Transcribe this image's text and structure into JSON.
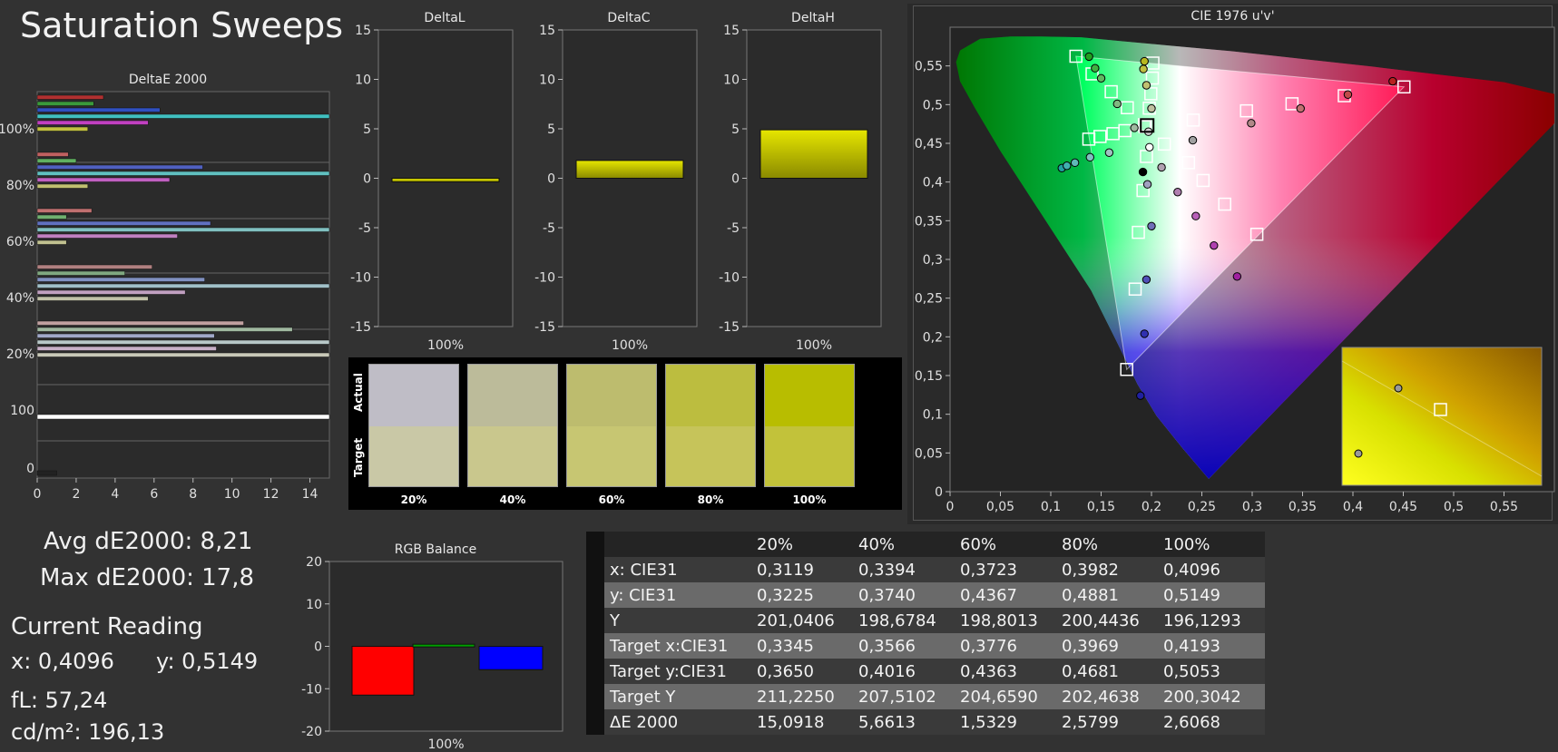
{
  "page_title": "Saturation Sweeps",
  "stats": {
    "avg": "Avg dE2000: 8,21",
    "max": "Max dE2000: 17,8",
    "current_heading": "Current Reading",
    "x": "x: 0,4096",
    "y": "y: 0,5149",
    "fl": "fL: 57,24",
    "cdm2": "cd/m²: 196,13"
  },
  "table": {
    "headers": [
      "20%",
      "40%",
      "60%",
      "80%",
      "100%"
    ],
    "rows": [
      {
        "label": "x: CIE31",
        "values": [
          "0,3119",
          "0,3394",
          "0,3723",
          "0,3982",
          "0,4096"
        ]
      },
      {
        "label": "y: CIE31",
        "values": [
          "0,3225",
          "0,3740",
          "0,4367",
          "0,4881",
          "0,5149"
        ]
      },
      {
        "label": "Y",
        "values": [
          "201,0406",
          "198,6784",
          "198,8013",
          "200,4436",
          "196,1293"
        ]
      },
      {
        "label": "Target x:CIE31",
        "values": [
          "0,3345",
          "0,3566",
          "0,3776",
          "0,3969",
          "0,4193"
        ]
      },
      {
        "label": "Target y:CIE31",
        "values": [
          "0,3650",
          "0,4016",
          "0,4363",
          "0,4681",
          "0,5053"
        ]
      },
      {
        "label": "Target Y",
        "values": [
          "211,2250",
          "207,5102",
          "204,6590",
          "202,4638",
          "200,3042"
        ]
      },
      {
        "label": "ΔE 2000",
        "values": [
          "15,0918",
          "5,6613",
          "1,5329",
          "2,5799",
          "2,6068"
        ]
      }
    ]
  },
  "swatches": {
    "actual_label": "Actual",
    "target_label": "Target",
    "items": [
      {
        "label": "20%",
        "actual": "#bfbdc6",
        "target": "#c9c8a6"
      },
      {
        "label": "40%",
        "actual": "#bcbb9a",
        "target": "#c9c78d"
      },
      {
        "label": "60%",
        "actual": "#bdbc6e",
        "target": "#c7c672"
      },
      {
        "label": "80%",
        "actual": "#bcbd3f",
        "target": "#c6c45a"
      },
      {
        "label": "100%",
        "actual": "#b8bd00",
        "target": "#c2c23a"
      }
    ]
  },
  "chart_data": [
    {
      "type": "bar",
      "orientation": "horizontal",
      "title": "DeltaE 2000",
      "x_ticks": [
        "0",
        "2",
        "4",
        "6",
        "8",
        "10",
        "12",
        "14"
      ],
      "xlim": [
        0,
        15
      ],
      "y_ticks": [
        "100%",
        "80%",
        "60%",
        "40%",
        "20%",
        "100",
        "0"
      ],
      "groups": [
        {
          "label": "100%",
          "bars": [
            {
              "value": 3.4,
              "color": "#b03030"
            },
            {
              "value": 2.9,
              "color": "#3a9a3a"
            },
            {
              "value": 6.3,
              "color": "#3050c0"
            },
            {
              "value": 17.8,
              "color": "#40c0c0"
            },
            {
              "value": 5.7,
              "color": "#c040c0"
            },
            {
              "value": 2.6,
              "color": "#c0c040"
            }
          ]
        },
        {
          "label": "80%",
          "bars": [
            {
              "value": 1.6,
              "color": "#c06060"
            },
            {
              "value": 2.0,
              "color": "#60b060"
            },
            {
              "value": 8.5,
              "color": "#5060c0"
            },
            {
              "value": 16.5,
              "color": "#60c0c0"
            },
            {
              "value": 6.8,
              "color": "#c060c0"
            },
            {
              "value": 2.6,
              "color": "#c0c070"
            }
          ]
        },
        {
          "label": "60%",
          "bars": [
            {
              "value": 2.8,
              "color": "#c07070"
            },
            {
              "value": 1.5,
              "color": "#70b070"
            },
            {
              "value": 8.9,
              "color": "#6070c0"
            },
            {
              "value": 16.0,
              "color": "#80c0c0"
            },
            {
              "value": 7.2,
              "color": "#c080c0"
            },
            {
              "value": 1.5,
              "color": "#c0c090"
            }
          ]
        },
        {
          "label": "40%",
          "bars": [
            {
              "value": 5.9,
              "color": "#b08080"
            },
            {
              "value": 4.5,
              "color": "#80a880"
            },
            {
              "value": 8.6,
              "color": "#8090c0"
            },
            {
              "value": 15.0,
              "color": "#a0c0c8"
            },
            {
              "value": 7.6,
              "color": "#c0a0c0"
            },
            {
              "value": 5.7,
              "color": "#c0c0a8"
            }
          ]
        },
        {
          "label": "20%",
          "bars": [
            {
              "value": 10.6,
              "color": "#c0a0a0"
            },
            {
              "value": 13.1,
              "color": "#a0b8a0"
            },
            {
              "value": 9.1,
              "color": "#a0a8c8"
            },
            {
              "value": 15.1,
              "color": "#b8c8c8"
            },
            {
              "value": 9.2,
              "color": "#c8b0c8"
            },
            {
              "value": 15.1,
              "color": "#c8c8b8"
            }
          ]
        },
        {
          "label": "100",
          "bars": [
            {
              "value": 15.0,
              "color": "#ffffff"
            }
          ]
        },
        {
          "label": "0",
          "bars": [
            {
              "value": 1.0,
              "color": "#222222"
            }
          ]
        }
      ]
    },
    {
      "type": "bar",
      "title": "DeltaL",
      "categories": [
        "100%"
      ],
      "values": [
        -0.3
      ],
      "ylim": [
        -15,
        15
      ],
      "y_ticks": [
        "15",
        "10",
        "5",
        "0",
        "-5",
        "-10",
        "-15"
      ],
      "color": "#c8c800"
    },
    {
      "type": "bar",
      "title": "DeltaC",
      "categories": [
        "100%"
      ],
      "values": [
        1.8
      ],
      "ylim": [
        -15,
        15
      ],
      "y_ticks": [
        "15",
        "10",
        "5",
        "0",
        "-5",
        "-10",
        "-15"
      ],
      "color": "#c8c800"
    },
    {
      "type": "bar",
      "title": "DeltaH",
      "categories": [
        "100%"
      ],
      "values": [
        4.9
      ],
      "ylim": [
        -15,
        15
      ],
      "y_ticks": [
        "15",
        "10",
        "5",
        "0",
        "-5",
        "-10",
        "-15"
      ],
      "color": "#c8c800"
    },
    {
      "type": "bar",
      "title": "RGB Balance",
      "categories": [
        "100%"
      ],
      "series": [
        {
          "values": [
            -11.5
          ],
          "color": "#ff0000"
        },
        {
          "values": [
            0.5
          ],
          "color": "#00a000"
        },
        {
          "values": [
            -5.5
          ],
          "color": "#0000ff"
        }
      ],
      "ylim": [
        -20,
        20
      ],
      "y_ticks": [
        "20",
        "10",
        "0",
        "-10",
        "-20"
      ]
    },
    {
      "type": "scatter",
      "title": "CIE 1976 u'v'",
      "xlim": [
        0,
        0.6
      ],
      "ylim": [
        0,
        0.6
      ],
      "x_ticks": [
        "0",
        "0,05",
        "0,1",
        "0,15",
        "0,2",
        "0,25",
        "0,3",
        "0,35",
        "0,4",
        "0,45",
        "0,5",
        "0,55"
      ],
      "y_ticks": [
        "0",
        "0,05",
        "0,1",
        "0,15",
        "0,2",
        "0,25",
        "0,3",
        "0,35",
        "0,4",
        "0,45",
        "0,5",
        "0,55"
      ],
      "gamut": {
        "red": [
          0.4507,
          0.5229
        ],
        "green": [
          0.125,
          0.5625
        ],
        "blue": [
          0.1754,
          0.1579
        ]
      },
      "targets": [
        [
          0.4507,
          0.5229
        ],
        [
          0.3914,
          0.5115
        ],
        [
          0.3395,
          0.5011
        ],
        [
          0.2943,
          0.492
        ],
        [
          0.2414,
          0.48
        ],
        [
          0.125,
          0.5625
        ],
        [
          0.141,
          0.5397
        ],
        [
          0.16,
          0.5167
        ],
        [
          0.176,
          0.496
        ],
        [
          0.193,
          0.474
        ],
        [
          0.1754,
          0.1579
        ],
        [
          0.1838,
          0.2617
        ],
        [
          0.187,
          0.335
        ],
        [
          0.1916,
          0.389
        ],
        [
          0.195,
          0.433
        ],
        [
          0.3046,
          0.3325
        ],
        [
          0.2727,
          0.3714
        ],
        [
          0.2512,
          0.402
        ],
        [
          0.2367,
          0.425
        ],
        [
          0.2128,
          0.449
        ],
        [
          0.1378,
          0.4554
        ],
        [
          0.1489,
          0.4588
        ],
        [
          0.1618,
          0.4625
        ],
        [
          0.1736,
          0.4664
        ],
        [
          0.1936,
          0.4715
        ],
        [
          0.2014,
          0.5537
        ],
        [
          0.2009,
          0.5343
        ],
        [
          0.1994,
          0.514
        ],
        [
          0.1978,
          0.4954
        ],
        [
          0.1957,
          0.4731
        ]
      ],
      "measured": [
        {
          "uv": [
            0.4395,
            0.5302
          ],
          "color": "#b82020"
        },
        {
          "uv": [
            0.395,
            0.513
          ],
          "color": "#c04a4a"
        },
        {
          "uv": [
            0.348,
            0.495
          ],
          "color": "#c07070"
        },
        {
          "uv": [
            0.299,
            0.476
          ],
          "color": "#b08888"
        },
        {
          "uv": [
            0.241,
            0.454
          ],
          "color": "#a0a0a0"
        },
        {
          "uv": [
            0.138,
            0.562
          ],
          "color": "#20a020"
        },
        {
          "uv": [
            0.144,
            0.547
          ],
          "color": "#40b040"
        },
        {
          "uv": [
            0.15,
            0.534
          ],
          "color": "#60b860"
        },
        {
          "uv": [
            0.166,
            0.501
          ],
          "color": "#80b880"
        },
        {
          "uv": [
            0.183,
            0.47
          ],
          "color": "#a0b8a0"
        },
        {
          "uv": [
            0.189,
            0.124
          ],
          "color": "#2020a0"
        },
        {
          "uv": [
            0.193,
            0.204
          ],
          "color": "#3030b0"
        },
        {
          "uv": [
            0.195,
            0.274
          ],
          "color": "#5050b8"
        },
        {
          "uv": [
            0.2,
            0.343
          ],
          "color": "#7070b8"
        },
        {
          "uv": [
            0.196,
            0.397
          ],
          "color": "#a0a0c0"
        },
        {
          "uv": [
            0.285,
            0.278
          ],
          "color": "#a020a0"
        },
        {
          "uv": [
            0.262,
            0.318
          ],
          "color": "#b040b0"
        },
        {
          "uv": [
            0.244,
            0.356
          ],
          "color": "#b860b8"
        },
        {
          "uv": [
            0.226,
            0.387
          ],
          "color": "#b080b0"
        },
        {
          "uv": [
            0.21,
            0.419
          ],
          "color": "#b0a0b0"
        },
        {
          "uv": [
            0.111,
            0.418
          ],
          "color": "#20a0a0"
        },
        {
          "uv": [
            0.116,
            0.421
          ],
          "color": "#40b0b0"
        },
        {
          "uv": [
            0.124,
            0.425
          ],
          "color": "#60b8b8"
        },
        {
          "uv": [
            0.139,
            0.432
          ],
          "color": "#80c0c0"
        },
        {
          "uv": [
            0.158,
            0.438
          ],
          "color": "#a0c0c0"
        },
        {
          "uv": [
            0.193,
            0.556
          ],
          "color": "#b8b820"
        },
        {
          "uv": [
            0.192,
            0.546
          ],
          "color": "#c0c040"
        },
        {
          "uv": [
            0.195,
            0.525
          ],
          "color": "#c0c070"
        },
        {
          "uv": [
            0.2,
            0.495
          ],
          "color": "#c0c0a0"
        },
        {
          "uv": [
            0.197,
            0.465
          ],
          "color": "#d0d0d0"
        },
        {
          "uv": [
            0.198,
            0.445
          ],
          "color": "#ffffff"
        },
        {
          "uv": [
            0.1915,
            0.413
          ],
          "color": "#000000"
        }
      ],
      "inset": {
        "target": [
          0.4507,
          0.5229
        ],
        "measured": [
          0.4395,
          0.5302
        ]
      }
    }
  ]
}
